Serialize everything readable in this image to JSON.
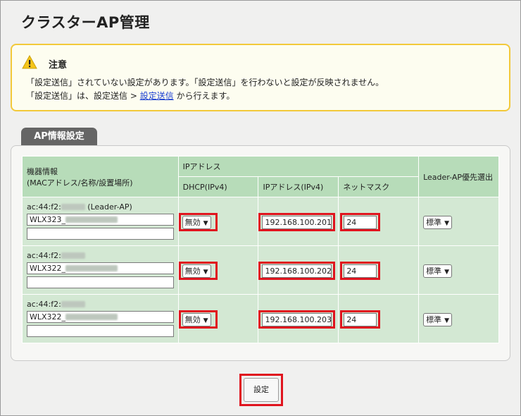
{
  "page": {
    "title": "クラスターAP管理"
  },
  "notice": {
    "title": "注意",
    "line1": "「設定送信」されていない設定があります。「設定送信」を行わないと設定が反映されません。",
    "line2_prefix": "「設定送信」は、設定送信 > ",
    "line2_link": "設定送信",
    "line2_suffix": " から行えます。",
    "icon": "warning-triangle-icon"
  },
  "tab": {
    "label": "AP情報設定"
  },
  "table": {
    "headers": {
      "device_info": "機器情報",
      "device_info_sub": "(MACアドレス/名称/設置場所)",
      "ip_address": "IPアドレス",
      "dhcp": "DHCP(IPv4)",
      "ipv4": "IPアドレス(IPv4)",
      "netmask": "ネットマスク",
      "leader": "Leader-AP優先選出"
    },
    "rows": [
      {
        "mac_prefix": "ac:44:f2:",
        "mac_suffix": "(Leader-AP)",
        "name": "WLX323_",
        "location": "",
        "dhcp": "無効",
        "ip": "192.168.100.201",
        "mask": "24",
        "leader": "標準"
      },
      {
        "mac_prefix": "ac:44:f2:",
        "mac_suffix": "",
        "name": "WLX322_",
        "location": "",
        "dhcp": "無効",
        "ip": "192.168.100.202",
        "mask": "24",
        "leader": "標準"
      },
      {
        "mac_prefix": "ac:44:f2:",
        "mac_suffix": "",
        "name": "WLX322_",
        "location": "",
        "dhcp": "無効",
        "ip": "192.168.100.203",
        "mask": "24",
        "leader": "標準"
      }
    ]
  },
  "buttons": {
    "set": "設定"
  },
  "colors": {
    "highlight": "#e0141e",
    "header_green": "#b7dcb9",
    "row_green": "#d3e8d3",
    "warning_border": "#f2c93a"
  }
}
